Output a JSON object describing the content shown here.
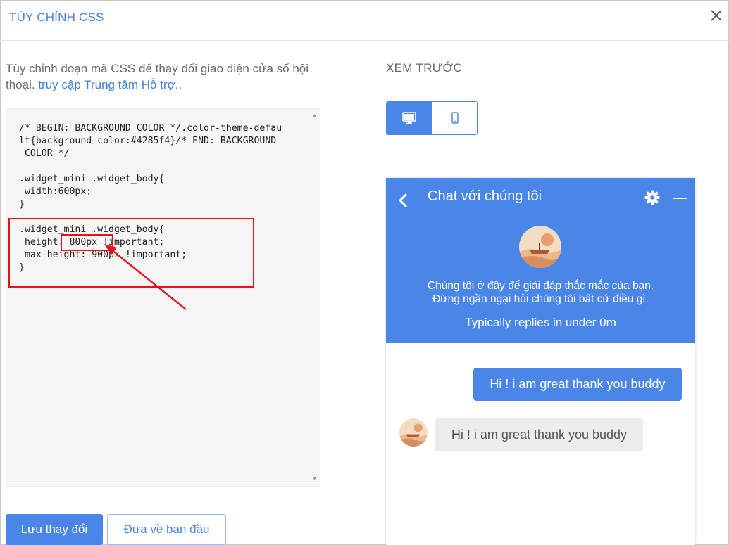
{
  "modal": {
    "title": "TÙY CHỈNH CSS"
  },
  "description": {
    "text": "Tùy chỉnh đoạn mã CSS để thay đổi giao diện cửa sổ hội thoại.",
    "link": "truy cập Trung tâm Hỗ trợ",
    "suffix": ".."
  },
  "editor": {
    "code": "/* BEGIN: BACKGROUND COLOR */.color-theme-defau\nlt{background-color:#4285f4}/* END: BACKGROUND\n COLOR */\n\n.widget_mini .widget_body{\n width:600px;\n}\n\n.widget_mini .widget_body{\n height: 800px !important;\n max-height: 900px !important;\n}"
  },
  "buttons": {
    "save": "Lưu thay đổi",
    "reset": "Đưa về ban đầu"
  },
  "preview": {
    "label": "XEM TRƯỚC"
  },
  "widget": {
    "title": "Chat với chúng tôi",
    "welcome_line1": "Chúng tôi ở đây để giải đáp thắc mắc của bạn.",
    "welcome_line2": "Đừng ngần ngại hỏi chúng tôi bất cứ điều gì.",
    "reply_time": "Typically replies in under 0m",
    "messages": [
      {
        "direction": "out",
        "text": "Hi ! i am great thank you buddy"
      },
      {
        "direction": "in",
        "text": "Hi ! i am great thank you buddy"
      }
    ]
  },
  "colors": {
    "accent": "#4a86e8",
    "highlight": "#e8101a",
    "link": "#3f7fd8"
  },
  "icons": [
    "close-icon",
    "desktop-icon",
    "mobile-icon",
    "back-chevron-icon",
    "gear-icon",
    "minimize-icon",
    "avatar"
  ]
}
